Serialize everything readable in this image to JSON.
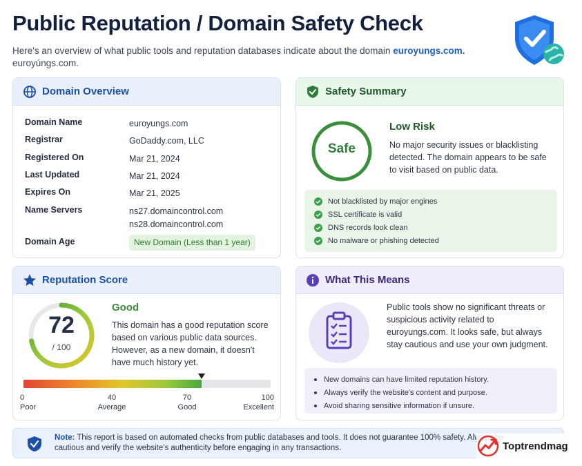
{
  "header": {
    "title": "Public Reputation / Domain Safety Check",
    "subtitle_text": "Here's an overview of what public tools and reputation databases indicate about the domain",
    "subtitle_domain": "euroyungs.com.",
    "subtitle_line2": "euroyúngs.com."
  },
  "domain_overview": {
    "title": "Domain Overview",
    "rows": [
      {
        "label": "Domain Name",
        "value": "euroyungs.com"
      },
      {
        "label": "Registrar",
        "value": "GoDaddy.com, LLC"
      },
      {
        "label": "Registered On",
        "value": "Mar 21, 2024"
      },
      {
        "label": "Last Updated",
        "value": "Mar 21, 2024"
      },
      {
        "label": "Expires On",
        "value": "Mar 21, 2025"
      },
      {
        "label": "Name Servers",
        "value": "ns27.domaincontrol.com",
        "value2": "ns28.domaincontrol.com"
      },
      {
        "label": "Domain Age",
        "value": "New Domain (Less than 1 year)"
      }
    ]
  },
  "safety_summary": {
    "title": "Safety Summary",
    "badge": "Safe",
    "risk_title": "Low Risk",
    "risk_desc": "No major security issues or blacklisting detected. The domain appears to be safe to visit based on public data.",
    "checks": [
      "Not blacklisted by major engines",
      "SSL certificate is valid",
      "DNS records look clean",
      "No malware or phishing detected"
    ]
  },
  "reputation": {
    "title": "Reputation Score",
    "score": "72",
    "score_value": 72,
    "score_max": "/ 100",
    "rating": "Good",
    "desc": "This domain has a good reputation score based on various public data sources. However, as a new domain, it doesn't have much history yet.",
    "scale": [
      {
        "value": "0",
        "label": "Poor"
      },
      {
        "value": "40",
        "label": "Average"
      },
      {
        "value": "70",
        "label": "Good"
      },
      {
        "value": "100",
        "label": "Excellent"
      }
    ]
  },
  "what_this_means": {
    "title": "What This Means",
    "desc": "Public tools show no significant threats or suspicious activity related to euroyungs.com. It looks safe, but always stay cautious and use your own judgment.",
    "tips": [
      "New domains can have limited reputation history.",
      "Always verify the website's content and purpose.",
      "Avoid sharing sensitive information if unsure."
    ]
  },
  "note": {
    "label": "Note:",
    "text": "This report is based on automated checks from public databases and tools. It does not guarantee 100% safety. Always be cautious and verify the website's authenticity before engaging in any transactions."
  },
  "brand": {
    "name": "Toptrendmag"
  },
  "colors": {
    "primary_blue": "#1c4fa8",
    "safe_green": "#3aa14a",
    "purple": "#3b2a78",
    "title_navy": "#13213f"
  },
  "icons": {
    "header_logo": "shield-check-globe-icon",
    "domain_overview": "globe-icon",
    "safety_summary": "shield-check-icon",
    "reputation": "star-icon",
    "what_this_means": "info-icon",
    "means_illustration": "clipboard-checklist-icon",
    "note": "shield-check-icon",
    "brand": "trend-arrow-logo-icon"
  }
}
